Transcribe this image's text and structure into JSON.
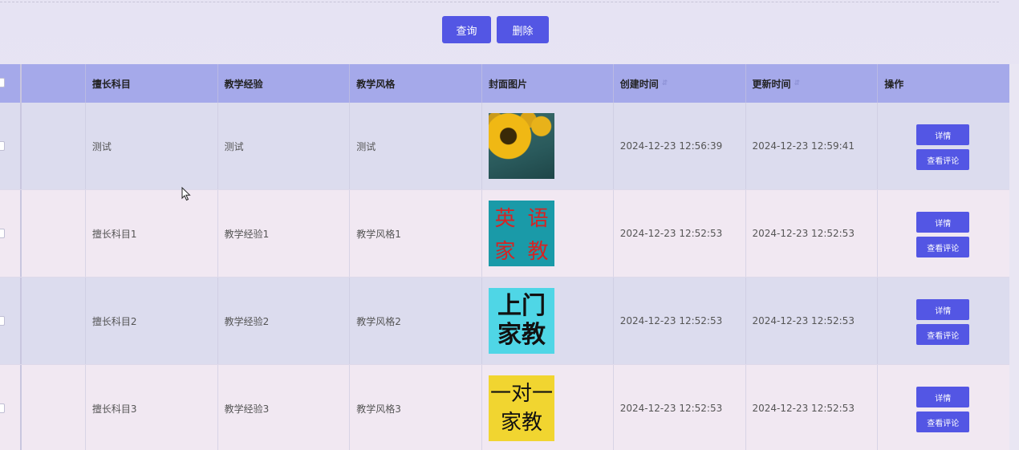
{
  "toolbar": {
    "query_label": "查询",
    "delete_label": "删除"
  },
  "table": {
    "headers": {
      "subject": "擅长科目",
      "experience": "教学经验",
      "style": "教学风格",
      "cover": "封面图片",
      "created": "创建时间",
      "updated": "更新时间",
      "actions": "操作"
    },
    "rows": [
      {
        "subject": "测试",
        "experience": "测试",
        "style": "测试",
        "cover_icon": "sunflower-image",
        "created": "2024-12-23 12:56:39",
        "updated": "2024-12-23 12:59:41",
        "detail_label": "详情",
        "comments_label": "查看评论"
      },
      {
        "subject": "擅长科目1",
        "experience": "教学经验1",
        "style": "教学风格1",
        "cover_icon": "english-tutor-image",
        "cover_text": [
          "英",
          "语",
          "家",
          "教"
        ],
        "created": "2024-12-23 12:52:53",
        "updated": "2024-12-23 12:52:53",
        "detail_label": "详情",
        "comments_label": "查看评论"
      },
      {
        "subject": "擅长科目2",
        "experience": "教学经验2",
        "style": "教学风格2",
        "cover_icon": "home-tutor-image",
        "cover_text": [
          "上门",
          "家教"
        ],
        "created": "2024-12-23 12:52:53",
        "updated": "2024-12-23 12:52:53",
        "detail_label": "详情",
        "comments_label": "查看评论"
      },
      {
        "subject": "擅长科目3",
        "experience": "教学经验3",
        "style": "教学风格3",
        "cover_icon": "one-on-one-tutor-image",
        "cover_text": [
          "一对一",
          "家教"
        ],
        "created": "2024-12-23 12:52:53",
        "updated": "2024-12-23 12:52:53",
        "detail_label": "详情",
        "comments_label": "查看评论"
      }
    ]
  },
  "colors": {
    "accent": "#5356e4",
    "header_bg": "#a5a9ea",
    "row_odd": "#dcdcee",
    "row_even": "#f1e8f2"
  }
}
